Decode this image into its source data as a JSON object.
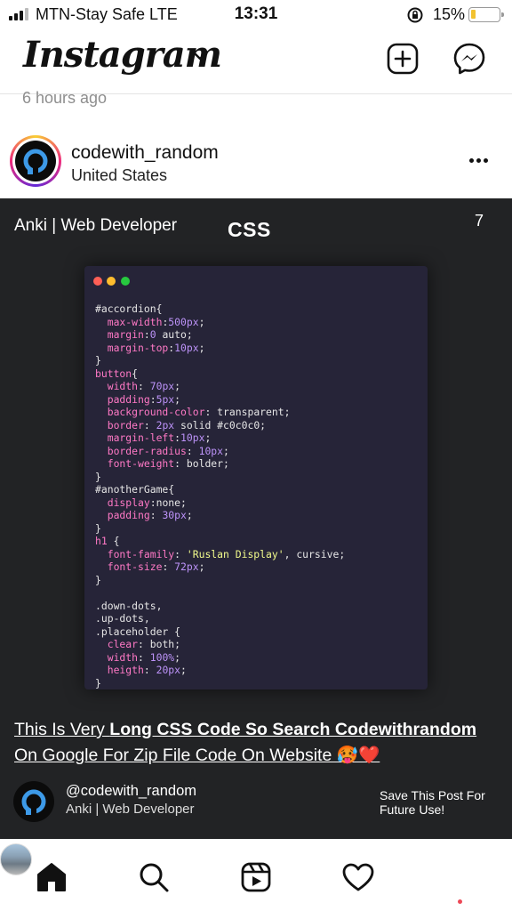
{
  "status": {
    "carrier": "MTN-Stay Safe  LTE",
    "time": "13:31",
    "battery": "15%"
  },
  "header": {
    "logo": "Instagram"
  },
  "feed": {
    "time_ago": "6 hours ago"
  },
  "post": {
    "username": "codewith_random",
    "location": "United States",
    "image": {
      "author": "Anki | Web Developer",
      "tag": "CSS",
      "slide_count": "7",
      "code": [
        [
          {
            "t": "#accordion{",
            "c": "sel"
          }
        ],
        [
          {
            "t": "  max-width",
            "c": "prop"
          },
          {
            "t": ":",
            "c": "plain"
          },
          {
            "t": "500px",
            "c": "val"
          },
          {
            "t": ";",
            "c": "plain"
          }
        ],
        [
          {
            "t": "  margin",
            "c": "prop"
          },
          {
            "t": ":",
            "c": "plain"
          },
          {
            "t": "0",
            "c": "val"
          },
          {
            "t": " auto;",
            "c": "plain"
          }
        ],
        [
          {
            "t": "  margin-top",
            "c": "prop"
          },
          {
            "t": ":",
            "c": "plain"
          },
          {
            "t": "10px",
            "c": "val"
          },
          {
            "t": ";",
            "c": "plain"
          }
        ],
        [
          {
            "t": "}",
            "c": "plain"
          }
        ],
        [
          {
            "t": "button",
            "c": "prop"
          },
          {
            "t": "{",
            "c": "plain"
          }
        ],
        [
          {
            "t": "  width",
            "c": "prop"
          },
          {
            "t": ": ",
            "c": "plain"
          },
          {
            "t": "70px",
            "c": "val"
          },
          {
            "t": ";",
            "c": "plain"
          }
        ],
        [
          {
            "t": "  padding",
            "c": "prop"
          },
          {
            "t": ":",
            "c": "plain"
          },
          {
            "t": "5px",
            "c": "val"
          },
          {
            "t": ";",
            "c": "plain"
          }
        ],
        [
          {
            "t": "  background-color",
            "c": "prop"
          },
          {
            "t": ": transparent;",
            "c": "plain"
          }
        ],
        [
          {
            "t": "  border",
            "c": "prop"
          },
          {
            "t": ": ",
            "c": "plain"
          },
          {
            "t": "2px",
            "c": "val"
          },
          {
            "t": " solid #c0c0c0;",
            "c": "plain"
          }
        ],
        [
          {
            "t": "  margin-left",
            "c": "prop"
          },
          {
            "t": ":",
            "c": "plain"
          },
          {
            "t": "10px",
            "c": "val"
          },
          {
            "t": ";",
            "c": "plain"
          }
        ],
        [
          {
            "t": "  border-radius",
            "c": "prop"
          },
          {
            "t": ": ",
            "c": "plain"
          },
          {
            "t": "10px",
            "c": "val"
          },
          {
            "t": ";",
            "c": "plain"
          }
        ],
        [
          {
            "t": "  font-weight",
            "c": "prop"
          },
          {
            "t": ": bolder;",
            "c": "plain"
          }
        ],
        [
          {
            "t": "}",
            "c": "plain"
          }
        ],
        [
          {
            "t": "#anotherGame{",
            "c": "sel"
          }
        ],
        [
          {
            "t": "  display",
            "c": "prop"
          },
          {
            "t": ":none;",
            "c": "plain"
          }
        ],
        [
          {
            "t": "  padding",
            "c": "prop"
          },
          {
            "t": ": ",
            "c": "plain"
          },
          {
            "t": "30px",
            "c": "val"
          },
          {
            "t": ";",
            "c": "plain"
          }
        ],
        [
          {
            "t": "}",
            "c": "plain"
          }
        ],
        [
          {
            "t": "h1",
            "c": "prop"
          },
          {
            "t": " {",
            "c": "plain"
          }
        ],
        [
          {
            "t": "  font-family",
            "c": "prop"
          },
          {
            "t": ": ",
            "c": "plain"
          },
          {
            "t": "'Ruslan Display'",
            "c": "str"
          },
          {
            "t": ", cursive;",
            "c": "plain"
          }
        ],
        [
          {
            "t": "  font-size",
            "c": "prop"
          },
          {
            "t": ": ",
            "c": "plain"
          },
          {
            "t": "72px",
            "c": "val"
          },
          {
            "t": ";",
            "c": "plain"
          }
        ],
        [
          {
            "t": "}",
            "c": "plain"
          }
        ],
        [
          {
            "t": "",
            "c": "plain"
          }
        ],
        [
          {
            "t": ".down-dots,",
            "c": "sel"
          }
        ],
        [
          {
            "t": ".up-dots,",
            "c": "sel"
          }
        ],
        [
          {
            "t": ".placeholder {",
            "c": "sel"
          }
        ],
        [
          {
            "t": "  clear",
            "c": "prop"
          },
          {
            "t": ": both;",
            "c": "plain"
          }
        ],
        [
          {
            "t": "  width",
            "c": "prop"
          },
          {
            "t": ": ",
            "c": "plain"
          },
          {
            "t": "100%",
            "c": "val"
          },
          {
            "t": ";",
            "c": "plain"
          }
        ],
        [
          {
            "t": "  heigth",
            "c": "prop"
          },
          {
            "t": ": ",
            "c": "plain"
          },
          {
            "t": "20px",
            "c": "val"
          },
          {
            "t": ";",
            "c": "plain"
          }
        ],
        [
          {
            "t": "}",
            "c": "plain"
          }
        ]
      ],
      "caption_line1_plain": "This Is Very ",
      "caption_line1_bold": "Long CSS Code So Search Codewithrandom",
      "caption_line2": "On Google For Zip File Code On Website 🥵❤️",
      "footer_handle": "@codewith_random",
      "footer_role": "Anki | Web Developer",
      "footer_save_line1": "Save This Post For",
      "footer_save_line2": "Future Use!"
    }
  },
  "icons": [
    "signal-icon",
    "lock-rotation-icon",
    "battery-icon",
    "chevron-down-icon",
    "new-post-icon",
    "messenger-icon",
    "more-icon",
    "home-icon",
    "search-icon",
    "reels-icon",
    "heart-icon",
    "profile-avatar"
  ],
  "colors": {
    "post_bg": "#222325",
    "code_bg": "#262438",
    "syntax_property": "#ff79c6",
    "syntax_number": "#bd93f9",
    "syntax_string": "#f1fa8c",
    "battery_low": "#f2c230",
    "notification_dot": "#ed4956"
  }
}
